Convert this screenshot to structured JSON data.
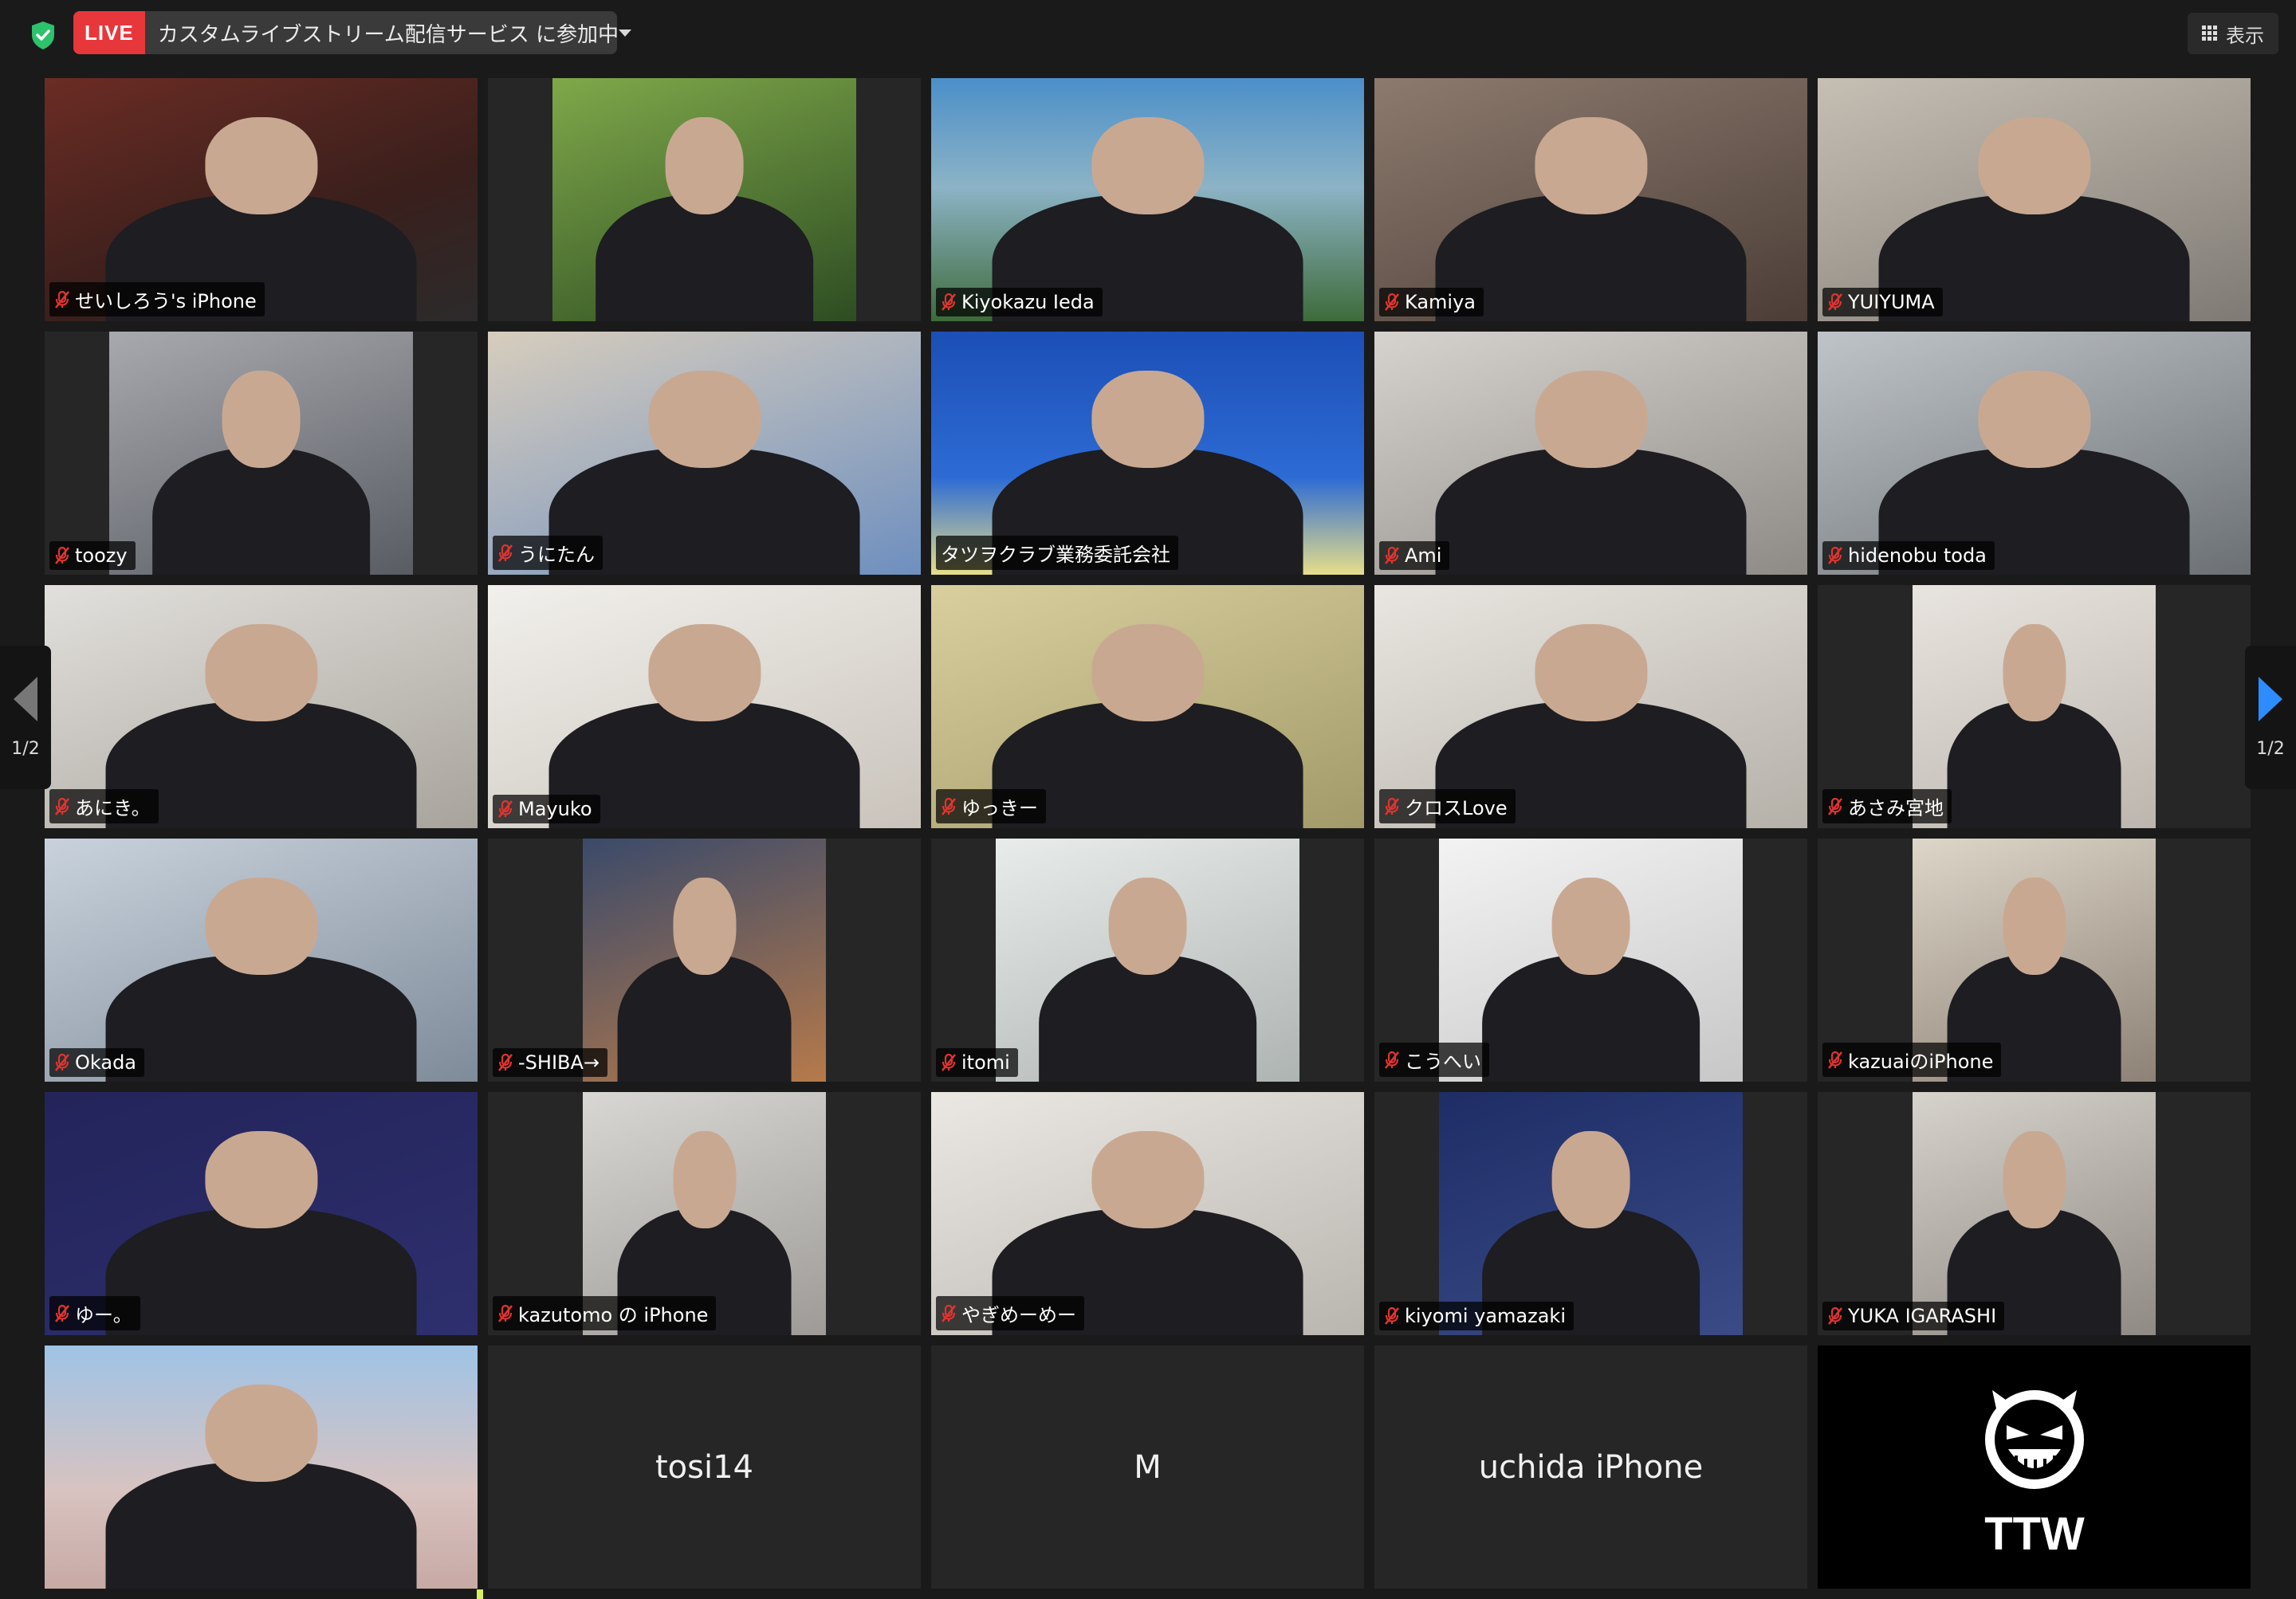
{
  "topbar": {
    "live_badge": "LIVE",
    "live_text": "カスタムライブストリーム配信サービス に参加中",
    "view_label": "表示"
  },
  "colors": {
    "live_red": "#e8373b",
    "active_speaker": "#d9f05a",
    "next_page_arrow": "#2d8cff",
    "shield_green": "#2dc26b"
  },
  "pagination": {
    "prev_label": "1/2",
    "next_label": "1/2"
  },
  "participants": [
    {
      "name": "せいしろう's iPhone",
      "muted": true,
      "video": true
    },
    {
      "name": "",
      "muted": false,
      "video": true
    },
    {
      "name": "Kiyokazu Ieda",
      "muted": true,
      "video": true
    },
    {
      "name": "Kamiya",
      "muted": true,
      "video": true
    },
    {
      "name": "YUIYUMA",
      "muted": true,
      "video": true
    },
    {
      "name": "toozy",
      "muted": true,
      "video": true
    },
    {
      "name": "うにたん",
      "muted": true,
      "video": true
    },
    {
      "name": "タツヲクラブ業務委託会社",
      "muted": false,
      "video": true,
      "active": true
    },
    {
      "name": "Ami",
      "muted": true,
      "video": true
    },
    {
      "name": "hidenobu toda",
      "muted": true,
      "video": true
    },
    {
      "name": "あにき。",
      "muted": true,
      "video": true
    },
    {
      "name": "Mayuko",
      "muted": true,
      "video": true
    },
    {
      "name": "ゆっきー",
      "muted": true,
      "video": true
    },
    {
      "name": "クロスLove",
      "muted": true,
      "video": true
    },
    {
      "name": "あさみ宮地",
      "muted": true,
      "video": true
    },
    {
      "name": "Okada",
      "muted": true,
      "video": true
    },
    {
      "name": "-SHIBA→",
      "muted": true,
      "video": true
    },
    {
      "name": "itomi",
      "muted": true,
      "video": true
    },
    {
      "name": "こうへい",
      "muted": true,
      "video": true
    },
    {
      "name": "kazuaiのiPhone",
      "muted": true,
      "video": true
    },
    {
      "name": "ゆー。",
      "muted": true,
      "video": true
    },
    {
      "name": "kazutomo の iPhone",
      "muted": true,
      "video": true
    },
    {
      "name": "やぎめーめー",
      "muted": true,
      "video": true
    },
    {
      "name": "kiyomi yamazaki",
      "muted": true,
      "video": true
    },
    {
      "name": "YUKA IGARASHI",
      "muted": true,
      "video": true
    },
    {
      "name": "",
      "muted": false,
      "video": true
    },
    {
      "name": "tosi14",
      "muted": false,
      "video": false
    },
    {
      "name": "M",
      "muted": false,
      "video": false
    },
    {
      "name": "uchida  iPhone",
      "muted": false,
      "video": false
    },
    {
      "name": "",
      "muted": false,
      "video": false,
      "avatar": "TTW"
    }
  ]
}
